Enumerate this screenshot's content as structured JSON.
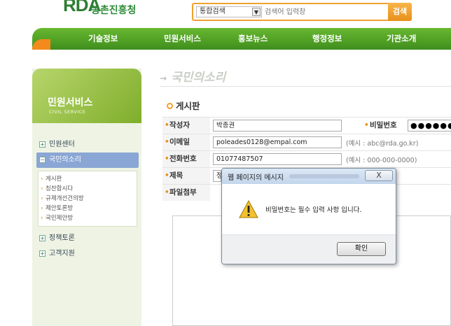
{
  "header": {
    "logo_mark": "RDA",
    "logo_text": "농촌진흥청",
    "search": {
      "category": "통합검색",
      "placeholder": "검색어 입력창",
      "button": "검색"
    }
  },
  "nav": {
    "items": [
      "기술정보",
      "민원서비스",
      "홍보뉴스",
      "행정정보",
      "기관소개"
    ]
  },
  "sidebar": {
    "title": "민원서비스",
    "subtitle": "CIVIL SERVICE",
    "menu": [
      {
        "label": "민원센터",
        "sign": "+"
      },
      {
        "label": "국민의소리",
        "sign": "−"
      }
    ],
    "submenu": [
      "게시판",
      "칭찬합시다",
      "규제개선건의방",
      "제안토론방",
      "국민제안방"
    ],
    "menu_after": [
      {
        "label": "정책토론",
        "sign": "+"
      },
      {
        "label": "고객지원",
        "sign": "+"
      }
    ]
  },
  "main": {
    "page_title": "국민의소리",
    "board_title": "게시판",
    "form": {
      "author_label": "작성자",
      "author_value": "박종권",
      "password_label": "비밀번호",
      "password_value": "●●●●●●",
      "email_label": "이메일",
      "email_value": "poleades0128@empal.com",
      "email_hint": "(예시 : abc@rda.go.kr)",
      "phone_label": "전화번호",
      "phone_value": "01077487507",
      "phone_hint": "(예시 : 000-000-0000)",
      "subject_label": "제목",
      "subject_value": "정",
      "attach_label": "파일첨부"
    }
  },
  "dialog": {
    "title": "웹 페이지의 메시지",
    "close": "X",
    "message": "비밀번호는 필수 입력 사항 입니다.",
    "ok": "확인",
    "icon": "warning-icon"
  },
  "colors": {
    "nav_green": "#4f9e24",
    "accent_orange": "#f0a030",
    "active_menu": "#8aa6d4"
  }
}
